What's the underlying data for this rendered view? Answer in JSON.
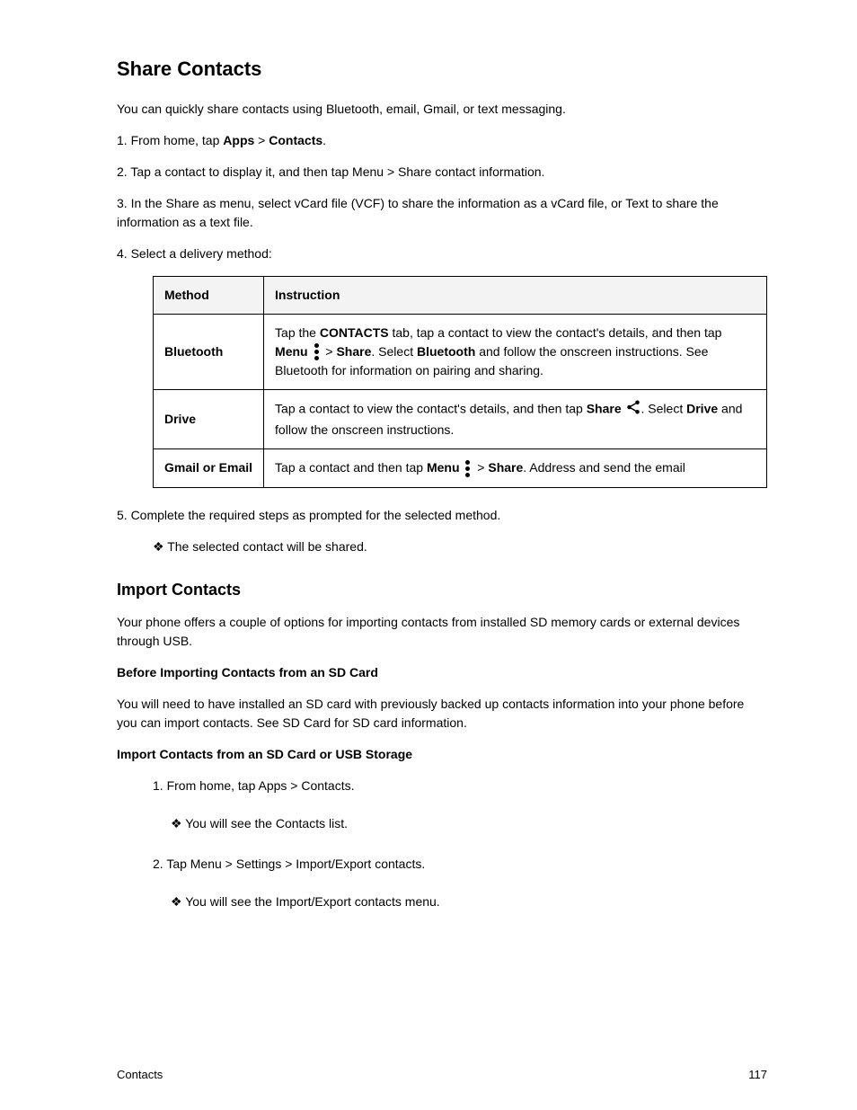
{
  "h1": "Share Contacts",
  "intro1": "You can quickly share contacts using Bluetooth, email, Gmail, or text messaging.",
  "step1_pre": "1. From home, tap ",
  "step1_apps": "Apps",
  "step1_red": " > ",
  "step1_contacts": "Contacts",
  "step1_post": ".",
  "step2": "2. Tap a contact to display it, and then tap Menu > Share contact information.",
  "step3": "3. In the Share as menu, select vCard file (VCF) to share the information as a vCard file, or Text to share the information as a text file.",
  "step4_intro": "4. Select a delivery method:",
  "table": {
    "headers": [
      "Method",
      "Instruction"
    ],
    "rows": [
      {
        "method": "Bluetooth",
        "cell_pre": "Tap the ",
        "cell_contacts": "CONTACTS",
        "cell_mid": " tab, tap a contact to view the contact's details, and then tap ",
        "cell_menu_word": "Menu",
        "cell_post1": " > ",
        "cell_share": "Share",
        "cell_post2": ". Select ",
        "cell_bt": "Bluetooth",
        "cell_post3": " and follow the onscreen instructions. See ",
        "cell_link": "Bluetooth",
        "cell_post4": " for information on pairing and sharing."
      },
      {
        "method": "Drive",
        "cell_pre": "Tap a contact to view the contact's details, and then tap ",
        "cell_share_word": "Share",
        "cell_post1": ". Select ",
        "cell_drive": "Drive",
        "cell_post2": " and follow the onscreen instructions."
      },
      {
        "method": "Gmail or Email",
        "cell_pre": "Tap a contact and then tap ",
        "cell_menu_word": "Menu",
        "cell_post1": " > ",
        "cell_share": "Share",
        "cell_post2": ". Address and send the email"
      }
    ]
  },
  "step5": "5. Complete the required steps as prompted for the selected method.",
  "result": "The selected contact will be shared.",
  "h2": "Import Contacts",
  "intro2_a": "Your phone offers a couple of options for importing contacts from installed SD memory cards or external devices through USB.",
  "intro2_b": "Before Importing Contacts from an SD Card",
  "intro2_c": "You will need to have installed an SD card with previously backed up contacts information into your phone before you can import contacts. See SD Card for SD card information.",
  "h3": "Import Contacts from an SD Card or USB Storage",
  "bullet1": "1. From home, tap Apps > Contacts.",
  "bullet2_pre": "You will see the Contacts list.",
  "bullet2": "2. Tap Menu > Settings > Import/Export contacts.",
  "bullet2_post": "You will see the Import/Export contacts menu.",
  "footer_left": "Contacts",
  "footer_right": "117"
}
